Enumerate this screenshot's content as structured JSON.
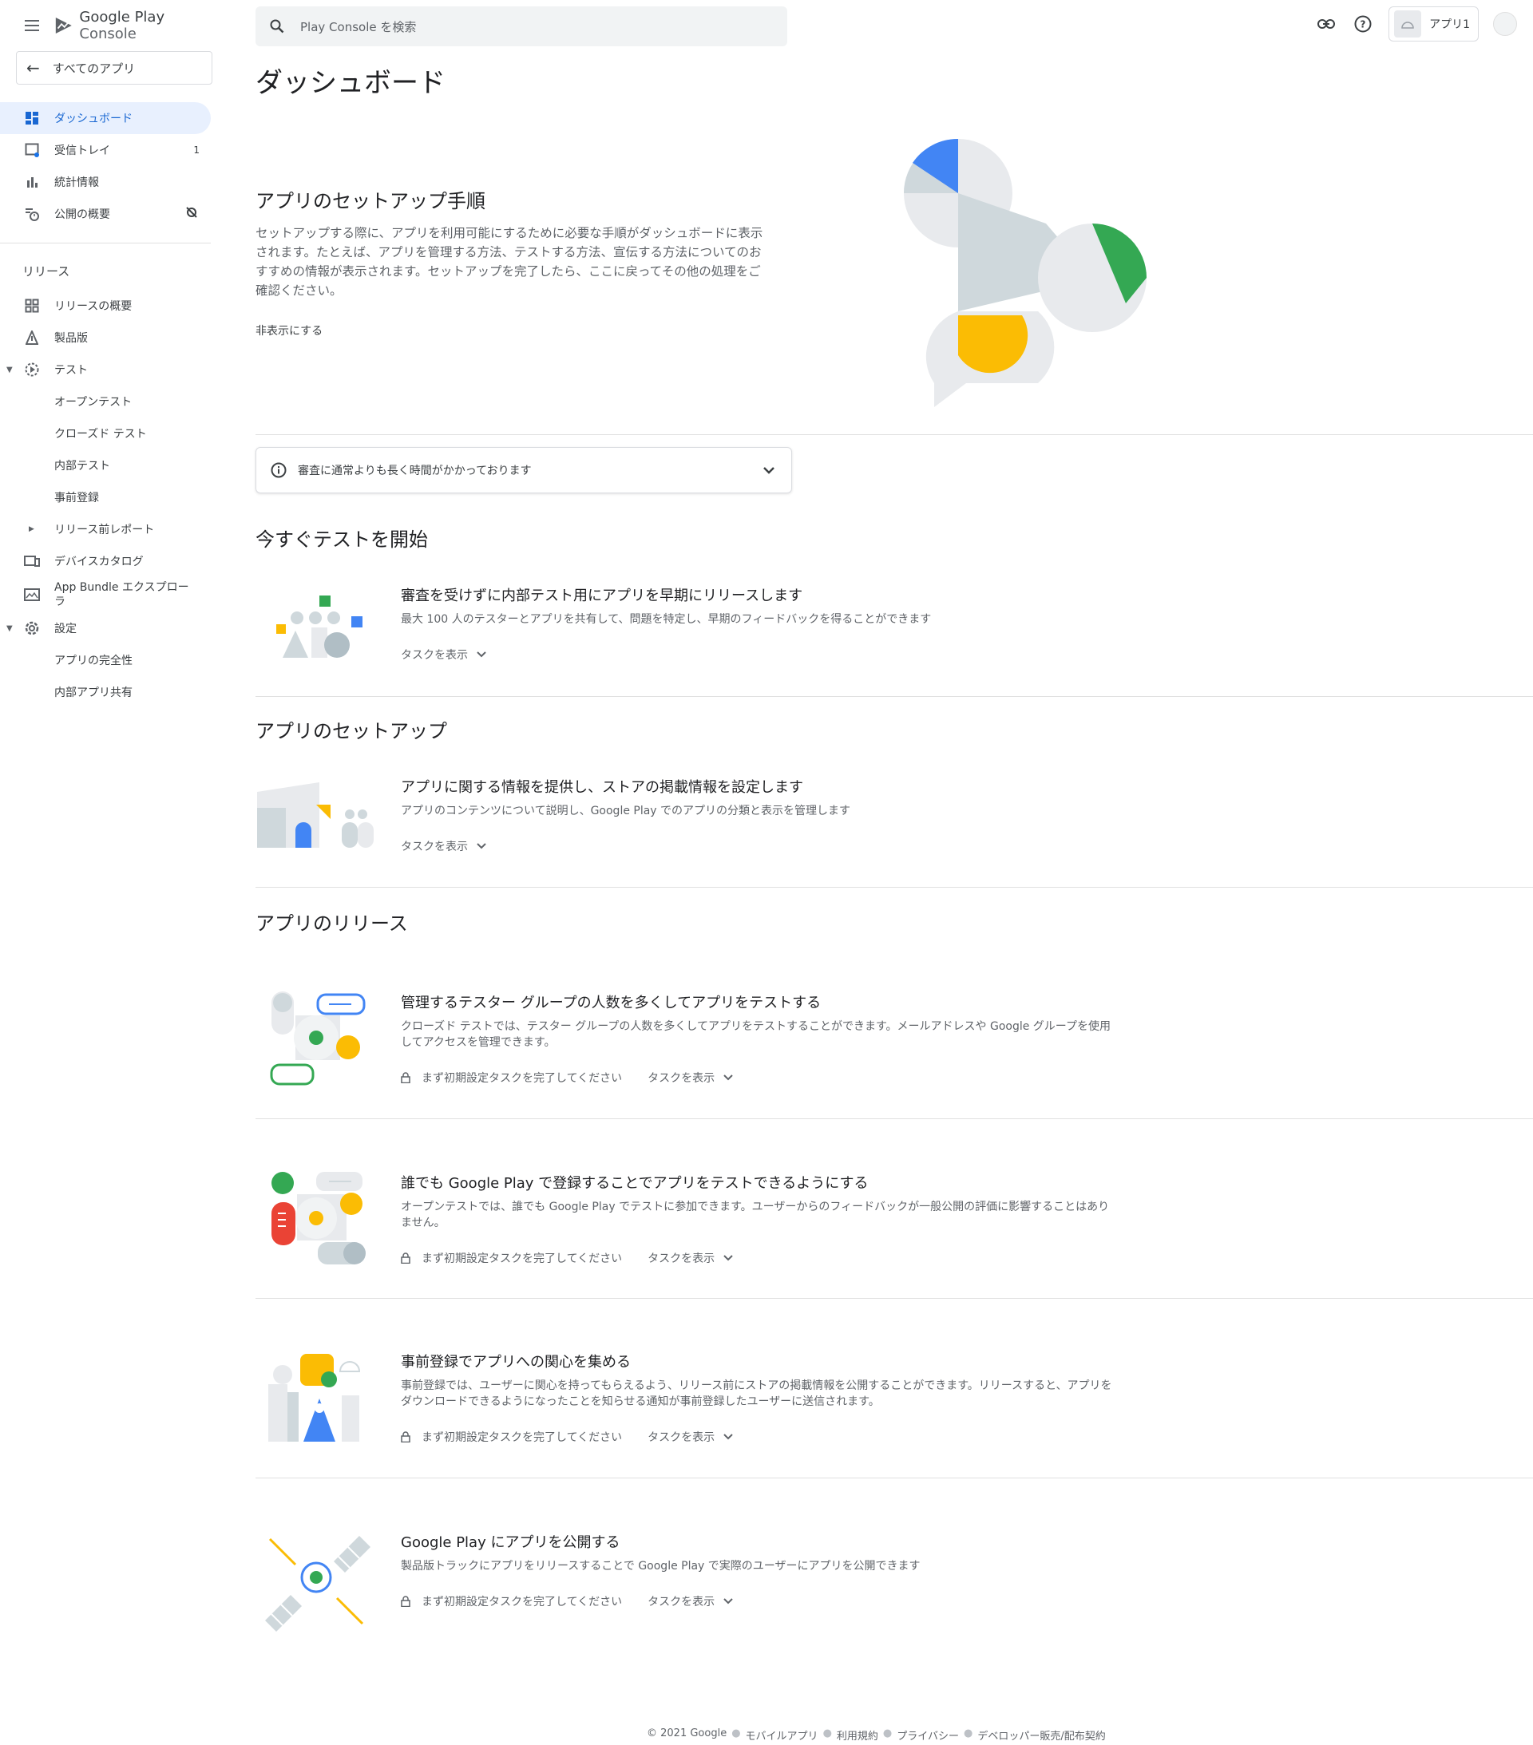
{
  "header": {
    "brand_google_play": "Google Play",
    "brand_console": "Console",
    "search_placeholder": "Play Console を検索",
    "app_name": "アプリ1"
  },
  "sidebar": {
    "all_apps": "すべてのアプリ",
    "items": [
      {
        "label": "ダッシュボード",
        "icon": "dashboard-icon",
        "active": true
      },
      {
        "label": "受信トレイ",
        "icon": "inbox-icon",
        "badge": "1"
      },
      {
        "label": "統計情報",
        "icon": "bar-chart-icon"
      },
      {
        "label": "公開の概要",
        "icon": "publishing-overview-icon"
      }
    ],
    "release_section": "リリース",
    "release_items": [
      {
        "label": "リリースの概要",
        "icon": "release-overview-icon"
      },
      {
        "label": "製品版",
        "icon": "production-icon"
      },
      {
        "label": "テスト",
        "icon": "test-icon"
      },
      {
        "label": "オープンテスト"
      },
      {
        "label": "クローズド テスト"
      },
      {
        "label": "内部テスト"
      },
      {
        "label": "事前登録"
      },
      {
        "label": "リリース前レポート"
      },
      {
        "label": "デバイスカタログ",
        "icon": "device-catalog-icon"
      },
      {
        "label": "App Bundle エクスプローラ",
        "icon": "app-bundle-icon"
      },
      {
        "label": "設定",
        "icon": "settings-icon"
      },
      {
        "label": "アプリの完全性"
      },
      {
        "label": "内部アプリ共有"
      }
    ]
  },
  "main": {
    "title": "ダッシュボード",
    "setup": {
      "heading": "アプリのセットアップ手順",
      "description": "セットアップする際に、アプリを利用可能にするために必要な手順がダッシュボードに表示されます。たとえば、アプリを管理する方法、テストする方法、宣伝する方法についてのおすすめの情報が表示されます。セットアップを完了したら、ここに戻ってその他の処理をご確認ください。",
      "hide": "非表示にする"
    },
    "notice": "審査に通常よりも長く時間がかかっております",
    "sections": [
      {
        "heading": "今すぐテストを開始",
        "cards": [
          {
            "title": "審査を受けずに内部テスト用にアプリを早期にリリースします",
            "desc": "最大 100 人のテスターとアプリを共有して、問題を特定し、早期のフィードバックを得ることができます",
            "task": "タスクを表示"
          }
        ]
      },
      {
        "heading": "アプリのセットアップ",
        "cards": [
          {
            "title": "アプリに関する情報を提供し、ストアの掲載情報を設定します",
            "desc": "アプリのコンテンツについて説明し、Google Play でのアプリの分類と表示を管理します",
            "task": "タスクを表示"
          }
        ]
      },
      {
        "heading": "アプリのリリース",
        "cards": [
          {
            "title": "管理するテスター グループの人数を多くしてアプリをテストする",
            "desc": "クローズド テストでは、テスター グループの人数を多くしてアプリをテストすることができます。メールアドレスや Google グループを使用してアクセスを管理できます。",
            "locked": "まず初期設定タスクを完了してください",
            "task": "タスクを表示"
          },
          {
            "title": "誰でも Google Play で登録することでアプリをテストできるようにする",
            "desc": "オープンテストでは、誰でも Google Play でテストに参加できます。ユーザーからのフィードバックが一般公開の評価に影響することはありません。",
            "locked": "まず初期設定タスクを完了してください",
            "task": "タスクを表示"
          },
          {
            "title": "事前登録でアプリへの関心を集める",
            "desc": "事前登録では、ユーザーに関心を持ってもらえるよう、リリース前にストアの掲載情報を公開することができます。リリースすると、アプリをダウンロードできるようになったことを知らせる通知が事前登録したユーザーに送信されます。",
            "locked": "まず初期設定タスクを完了してください",
            "task": "タスクを表示"
          },
          {
            "title": "Google Play にアプリを公開する",
            "desc": "製品版トラックにアプリをリリースすることで Google Play で実際のユーザーにアプリを公開できます",
            "locked": "まず初期設定タスクを完了してください",
            "task": "タスクを表示"
          }
        ]
      }
    ]
  },
  "footer": {
    "copyright": "© 2021 Google",
    "links": [
      "モバイルアプリ",
      "利用規約",
      "プライバシー",
      "デベロッパー販売/配布契約"
    ]
  },
  "colors": {
    "blue": "#4285f4",
    "green": "#34a853",
    "yellow": "#fbbc04",
    "red": "#ea4335",
    "grey": "#cfd8dc"
  }
}
